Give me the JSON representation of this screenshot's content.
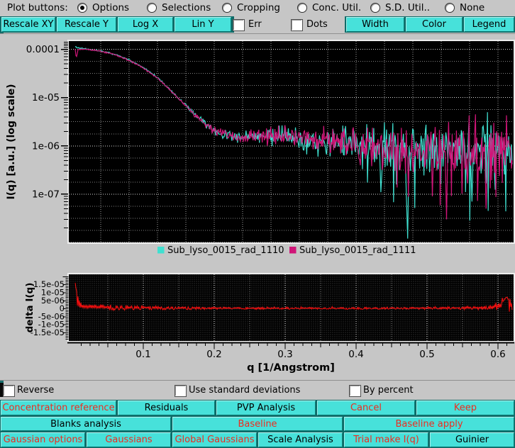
{
  "colors": {
    "window_bg": "#c6c6c6",
    "canvas_bg": "#000000",
    "button_face": "#47e1da",
    "button_frame": "#0f6b68",
    "red_text": "#ee2c1f",
    "cyan_series": "#3fe0d0",
    "magenta_series": "#d01578",
    "delta_series": "#ff1010"
  },
  "top_bar": {
    "label": "Plot buttons:",
    "radios": [
      {
        "label": "Options",
        "selected": true
      },
      {
        "label": "Selections",
        "selected": false
      },
      {
        "label": "Cropping",
        "selected": false
      },
      {
        "label": "Conc. Util.",
        "selected": false
      },
      {
        "label": "S.D. Util..",
        "selected": false
      },
      {
        "label": "None",
        "selected": false
      }
    ]
  },
  "toolbar": {
    "buttons": [
      {
        "label": "Rescale XY"
      },
      {
        "label": "Rescale Y"
      },
      {
        "label": "Log X"
      },
      {
        "label": "Lin Y"
      }
    ],
    "checkboxes": [
      {
        "label": "Err",
        "checked": false
      },
      {
        "label": "Dots",
        "checked": false
      }
    ],
    "right_buttons": [
      {
        "label": "Width"
      },
      {
        "label": "Color"
      },
      {
        "label": "Legend"
      }
    ]
  },
  "legend": {
    "items": [
      {
        "label": "Sub_lyso_0015_rad_1110",
        "color": "#3fe0d0"
      },
      {
        "label": "Sub_lyso_0015_rad_1111",
        "color": "#d01578"
      }
    ]
  },
  "chart_data": {
    "main_plot": {
      "type": "line",
      "ylabel": "I(q) [a.u.] (log scale)",
      "yscale": "log",
      "ylim": [
        1e-08,
        0.000148
      ],
      "xlim": [
        -0.005,
        0.622
      ],
      "q_range": [
        0.004,
        0.62
      ],
      "grid_x_step": 0.04,
      "yticks": [
        {
          "label": "0.0001",
          "value": 0.0001
        },
        {
          "label": "1e-05",
          "value": 1e-05
        },
        {
          "label": "1e-06",
          "value": 1e-06
        },
        {
          "label": "1e-07",
          "value": 1e-07
        }
      ],
      "noise_sigma_log10": [
        [
          0,
          0.006
        ],
        [
          0.15,
          0.01
        ],
        [
          0.2,
          0.045
        ],
        [
          0.25,
          0.07
        ],
        [
          0.3,
          0.1
        ],
        [
          0.35,
          0.13
        ],
        [
          0.4,
          0.17
        ],
        [
          0.45,
          0.22
        ],
        [
          0.5,
          0.26
        ],
        [
          0.55,
          0.3
        ],
        [
          0.62,
          0.34
        ]
      ],
      "series": [
        {
          "name": "Sub_lyso_0015_rad_1110",
          "color": "#3fe0d0",
          "seed": 11,
          "anchors": [
            [
              0.004,
              0.000115
            ],
            [
              0.008,
              0.000108
            ],
            [
              0.02,
              0.000101
            ],
            [
              0.04,
              9.3e-05
            ],
            [
              0.06,
              7.9e-05
            ],
            [
              0.08,
              6e-05
            ],
            [
              0.1,
              4.2e-05
            ],
            [
              0.12,
              2.6e-05
            ],
            [
              0.14,
              1.35e-05
            ],
            [
              0.16,
              6.8e-06
            ],
            [
              0.18,
              3.6e-06
            ],
            [
              0.2,
              2.15e-06
            ],
            [
              0.215,
              1.7e-06
            ],
            [
              0.23,
              1.5e-06
            ],
            [
              0.25,
              1.5e-06
            ],
            [
              0.27,
              1.55e-06
            ],
            [
              0.29,
              1.6e-06
            ],
            [
              0.31,
              1.55e-06
            ],
            [
              0.33,
              1.4e-06
            ],
            [
              0.35,
              1.3e-06
            ],
            [
              0.37,
              1.2e-06
            ],
            [
              0.4,
              1.1e-06
            ],
            [
              0.44,
              1e-06
            ],
            [
              0.48,
              9.5e-07
            ],
            [
              0.52,
              9e-07
            ],
            [
              0.56,
              9e-07
            ],
            [
              0.6,
              1e-06
            ],
            [
              0.62,
              1.2e-06
            ]
          ],
          "deep_spikes": [
            [
              0.435,
              1.1e-07
            ],
            [
              0.473,
              1.2e-08
            ],
            [
              0.563,
              7e-08
            ]
          ]
        },
        {
          "name": "Sub_lyso_0015_rad_1111",
          "color": "#d01578",
          "seed": 29,
          "anchors": [
            [
              0.004,
              0.0001
            ],
            [
              0.0055,
              6.6e-05
            ],
            [
              0.008,
              0.0001
            ],
            [
              0.02,
              0.0001
            ],
            [
              0.04,
              9.2e-05
            ],
            [
              0.06,
              7.8e-05
            ],
            [
              0.08,
              5.9e-05
            ],
            [
              0.1,
              4.1e-05
            ],
            [
              0.12,
              2.55e-05
            ],
            [
              0.14,
              1.33e-05
            ],
            [
              0.16,
              6.7e-06
            ],
            [
              0.18,
              3.55e-06
            ],
            [
              0.2,
              2.1e-06
            ],
            [
              0.215,
              1.68e-06
            ],
            [
              0.23,
              1.5e-06
            ],
            [
              0.25,
              1.5e-06
            ],
            [
              0.27,
              1.55e-06
            ],
            [
              0.29,
              1.6e-06
            ],
            [
              0.31,
              1.55e-06
            ],
            [
              0.33,
              1.4e-06
            ],
            [
              0.35,
              1.3e-06
            ],
            [
              0.37,
              1.2e-06
            ],
            [
              0.4,
              1.05e-06
            ],
            [
              0.44,
              9.5e-07
            ],
            [
              0.48,
              8.5e-07
            ],
            [
              0.52,
              8e-07
            ],
            [
              0.56,
              8.5e-07
            ],
            [
              0.6,
              9.5e-07
            ],
            [
              0.62,
              1.1e-06
            ]
          ],
          "deep_spikes": [
            [
              0.508,
              9e-08
            ],
            [
              0.527,
              3e-08
            ],
            [
              0.583,
              5e-08
            ]
          ]
        }
      ]
    },
    "delta_plot": {
      "type": "line",
      "ylabel": "delta I(q)",
      "ylim": [
        -2.011e-05,
        2.149e-05
      ],
      "color": "#ff1010",
      "seed": 5,
      "yticks": [
        {
          "label": "1.5e-05",
          "value": 1.5e-05
        },
        {
          "label": "1e-05",
          "value": 1e-05
        },
        {
          "label": "5e-06",
          "value": 5e-06
        },
        {
          "label": "0",
          "value": 0
        },
        {
          "label": "-5e-06",
          "value": -5e-06
        },
        {
          "label": "-1e-05",
          "value": -1e-05
        },
        {
          "label": "-1.5e-05",
          "value": -1.5e-05
        }
      ],
      "envelope": [
        [
          0.004,
          1.7e-05
        ],
        [
          0.008,
          8e-06
        ],
        [
          0.012,
          4e-06
        ],
        [
          0.02,
          3e-06
        ],
        [
          0.05,
          2.6e-06
        ],
        [
          0.08,
          2.2e-06
        ],
        [
          0.12,
          1.8e-06
        ],
        [
          0.16,
          1.4e-06
        ],
        [
          0.2,
          1.1e-06
        ],
        [
          0.25,
          9e-07
        ],
        [
          0.3,
          8e-07
        ],
        [
          0.35,
          8e-07
        ],
        [
          0.4,
          9e-07
        ],
        [
          0.45,
          9e-07
        ],
        [
          0.5,
          1e-06
        ],
        [
          0.54,
          1.1e-06
        ],
        [
          0.57,
          1.4e-06
        ],
        [
          0.59,
          2e-06
        ],
        [
          0.605,
          4e-06
        ],
        [
          0.612,
          8e-06
        ],
        [
          0.62,
          3e-06
        ]
      ]
    },
    "x_axis": {
      "label": "q [1/Angstrom]",
      "minor_step": 0.0125,
      "ticks": [
        {
          "label": "0.1",
          "value": 0.1
        },
        {
          "label": "0.2",
          "value": 0.2
        },
        {
          "label": "0.3",
          "value": 0.3
        },
        {
          "label": "0.4",
          "value": 0.4
        },
        {
          "label": "0.5",
          "value": 0.5
        },
        {
          "label": "0.6",
          "value": 0.6
        }
      ]
    }
  },
  "options_row": {
    "checkboxes": [
      {
        "label": "Reverse",
        "checked": false
      },
      {
        "label": "Use standard deviations",
        "checked": false
      },
      {
        "label": "By percent",
        "checked": false
      }
    ]
  },
  "actions": {
    "rows": [
      [
        {
          "label": "Concentration reference",
          "red": true
        },
        {
          "label": "Residuals",
          "red": false
        },
        {
          "label": "PVP Analysis",
          "red": false
        },
        {
          "label": "Cancel",
          "red": true
        },
        {
          "label": "Keep",
          "red": true
        }
      ],
      [
        {
          "label": "Blanks analysis",
          "red": false
        },
        {
          "label": "Baseline",
          "red": true
        },
        {
          "label": "Baseline apply",
          "red": true
        }
      ],
      [
        {
          "label": "Gaussian options",
          "red": true
        },
        {
          "label": "Gaussians",
          "red": true
        },
        {
          "label": "Global Gaussians",
          "red": true
        },
        {
          "label": "Scale Analysis",
          "red": false
        },
        {
          "label": "Trial make I(q)",
          "red": true
        },
        {
          "label": "Guinier",
          "red": false
        }
      ]
    ]
  }
}
